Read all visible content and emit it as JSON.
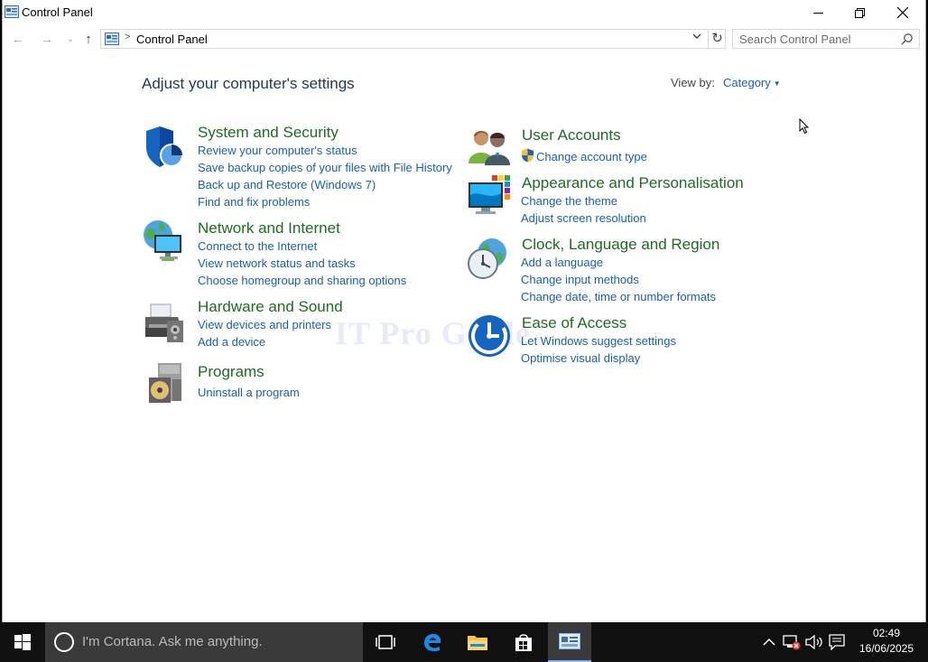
{
  "window": {
    "title": "Control Panel"
  },
  "navbar": {
    "back": "←",
    "forward": "→",
    "recent": "⌄",
    "up": "↑",
    "address_text": "Control Panel",
    "address_sep": ">",
    "refresh": "↻",
    "search_placeholder": "Search Control Panel"
  },
  "content": {
    "heading": "Adjust your computer's settings",
    "view_by_label": "View by:",
    "view_by_value": "Category",
    "watermark": "IT Pro Guide"
  },
  "categories": [
    {
      "title": "System and Security",
      "icon": "shield-icon",
      "links": [
        "Review your computer's status",
        "Save backup copies of your files with File History",
        "Back up and Restore (Windows 7)",
        "Find and fix problems"
      ]
    },
    {
      "title": "Network and Internet",
      "icon": "network-icon",
      "links": [
        "Connect to the Internet",
        "View network status and tasks",
        "Choose homegroup and sharing options"
      ]
    },
    {
      "title": "Hardware and Sound",
      "icon": "printer-icon",
      "links": [
        "View devices and printers",
        "Add a device"
      ]
    },
    {
      "title": "Programs",
      "icon": "programs-icon",
      "links": [
        "Uninstall a program"
      ]
    },
    {
      "title": "User Accounts",
      "icon": "users-icon",
      "links": [
        "Change account type"
      ]
    },
    {
      "title": "Appearance and Personalisation",
      "icon": "monitor-icon",
      "links": [
        "Change the theme",
        "Adjust screen resolution"
      ]
    },
    {
      "title": "Clock, Language and Region",
      "icon": "clock-globe-icon",
      "links": [
        "Add a language",
        "Change input methods",
        "Change date, time or number formats"
      ]
    },
    {
      "title": "Ease of Access",
      "icon": "ease-of-access-icon",
      "links": [
        "Let Windows suggest settings",
        "Optimise visual display"
      ]
    }
  ],
  "taskbar": {
    "cortana_text": "I'm Cortana. Ask me anything.",
    "time": "02:49",
    "date": "16/06/2025"
  },
  "colors": {
    "category_title": "#1e6b22",
    "link": "#1a5fb4",
    "heading": "#1e395b",
    "taskbar": "#101010"
  }
}
